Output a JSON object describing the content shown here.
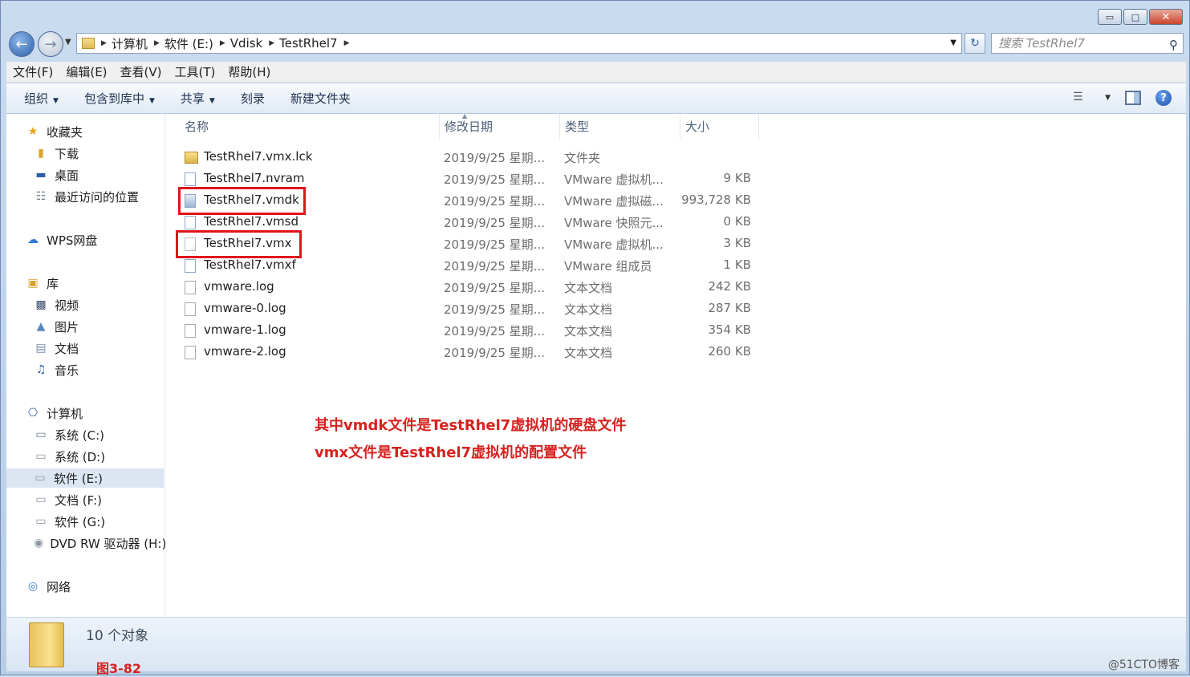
{
  "window": {
    "caption_buttons": {
      "minimize": "▭",
      "maximize": "□",
      "close": "✕"
    }
  },
  "address": {
    "crumbs": [
      "计算机",
      "软件 (E:)",
      "Vdisk",
      "TestRhel7"
    ],
    "search_placeholder": "搜索 TestRhel7"
  },
  "menu": [
    "文件(F)",
    "编辑(E)",
    "查看(V)",
    "工具(T)",
    "帮助(H)"
  ],
  "toolbar": {
    "organize": "组织",
    "include_library": "包含到库中",
    "share": "共享",
    "burn": "刻录",
    "new_folder": "新建文件夹"
  },
  "nav": {
    "favorites": "收藏夹",
    "downloads": "下载",
    "desktop": "桌面",
    "recent": "最近访问的位置",
    "wps": "WPS网盘",
    "libraries": "库",
    "videos": "视频",
    "pictures": "图片",
    "documents": "文档",
    "music": "音乐",
    "computer": "计算机",
    "drive_c": "系统 (C:)",
    "drive_d": "系统 (D:)",
    "drive_e": "软件 (E:)",
    "drive_f": "文档 (F:)",
    "drive_g": "软件 (G:)",
    "drive_h": "DVD RW 驱动器 (H:)",
    "network": "网络"
  },
  "columns": {
    "name": "名称",
    "date": "修改日期",
    "type": "类型",
    "size": "大小"
  },
  "files": [
    {
      "name": "TestRhel7.vmx.lck",
      "date": "2019/9/25 星期...",
      "type": "文件夹",
      "size": "",
      "icon": "folder-icon"
    },
    {
      "name": "TestRhel7.nvram",
      "date": "2019/9/25 星期...",
      "type": "VMware 虚拟机...",
      "size": "9 KB",
      "icon": "vmware-file-icon"
    },
    {
      "name": "TestRhel7.vmdk",
      "date": "2019/9/25 星期...",
      "type": "VMware 虚拟磁...",
      "size": "993,728 KB",
      "icon": "virtual-disk-icon"
    },
    {
      "name": "TestRhel7.vmsd",
      "date": "2019/9/25 星期...",
      "type": "VMware 快照元...",
      "size": "0 KB",
      "icon": "vmware-file-icon"
    },
    {
      "name": "TestRhel7.vmx",
      "date": "2019/9/25 星期...",
      "type": "VMware 虚拟机...",
      "size": "3 KB",
      "icon": "vmx-file-icon"
    },
    {
      "name": "TestRhel7.vmxf",
      "date": "2019/9/25 星期...",
      "type": "VMware 组成员",
      "size": "1 KB",
      "icon": "vmware-file-icon"
    },
    {
      "name": "vmware.log",
      "date": "2019/9/25 星期...",
      "type": "文本文档",
      "size": "242 KB",
      "icon": "text-file-icon"
    },
    {
      "name": "vmware-0.log",
      "date": "2019/9/25 星期...",
      "type": "文本文档",
      "size": "287 KB",
      "icon": "text-file-icon"
    },
    {
      "name": "vmware-1.log",
      "date": "2019/9/25 星期...",
      "type": "文本文档",
      "size": "354 KB",
      "icon": "text-file-icon"
    },
    {
      "name": "vmware-2.log",
      "date": "2019/9/25 星期...",
      "type": "文本文档",
      "size": "260 KB",
      "icon": "text-file-icon"
    }
  ],
  "annotation": {
    "line1": "其中vmdk文件是TestRhel7虚拟机的硬盘文件",
    "line2": "vmx文件是TestRhel7虚拟机的配置文件",
    "color": "#d6221f"
  },
  "details": {
    "count": "10 个对象",
    "figure_label": "图3-82",
    "watermark": "@51CTO博客"
  }
}
